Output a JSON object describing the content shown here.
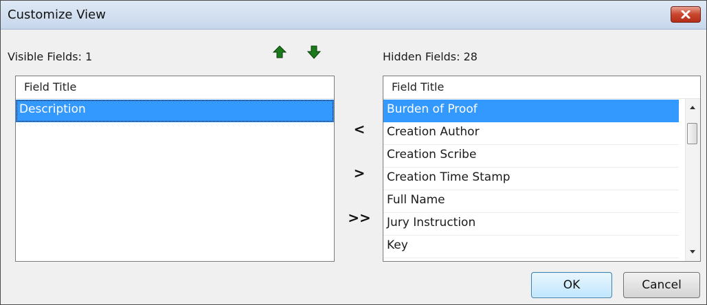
{
  "window": {
    "title": "Customize View"
  },
  "visible": {
    "label": "Visible Fields: 1",
    "header": "Field Title",
    "items": [
      "Description"
    ]
  },
  "hidden": {
    "label": "Hidden Fields: 28",
    "header": "Field Title",
    "items": [
      "Burden of Proof",
      "Creation Author",
      "Creation Scribe",
      "Creation Time Stamp",
      "Full Name",
      "Jury Instruction",
      "Key"
    ]
  },
  "controls": {
    "move_left": "<",
    "move_right": ">",
    "move_all_right": ">>"
  },
  "buttons": {
    "ok": "OK",
    "cancel": "Cancel"
  },
  "icons": {
    "up": "arrow-up-icon",
    "down": "arrow-down-icon",
    "close": "close-icon"
  },
  "colors": {
    "selection": "#3399ff",
    "arrows": "#1a7a1a",
    "close": "#c9452e"
  }
}
